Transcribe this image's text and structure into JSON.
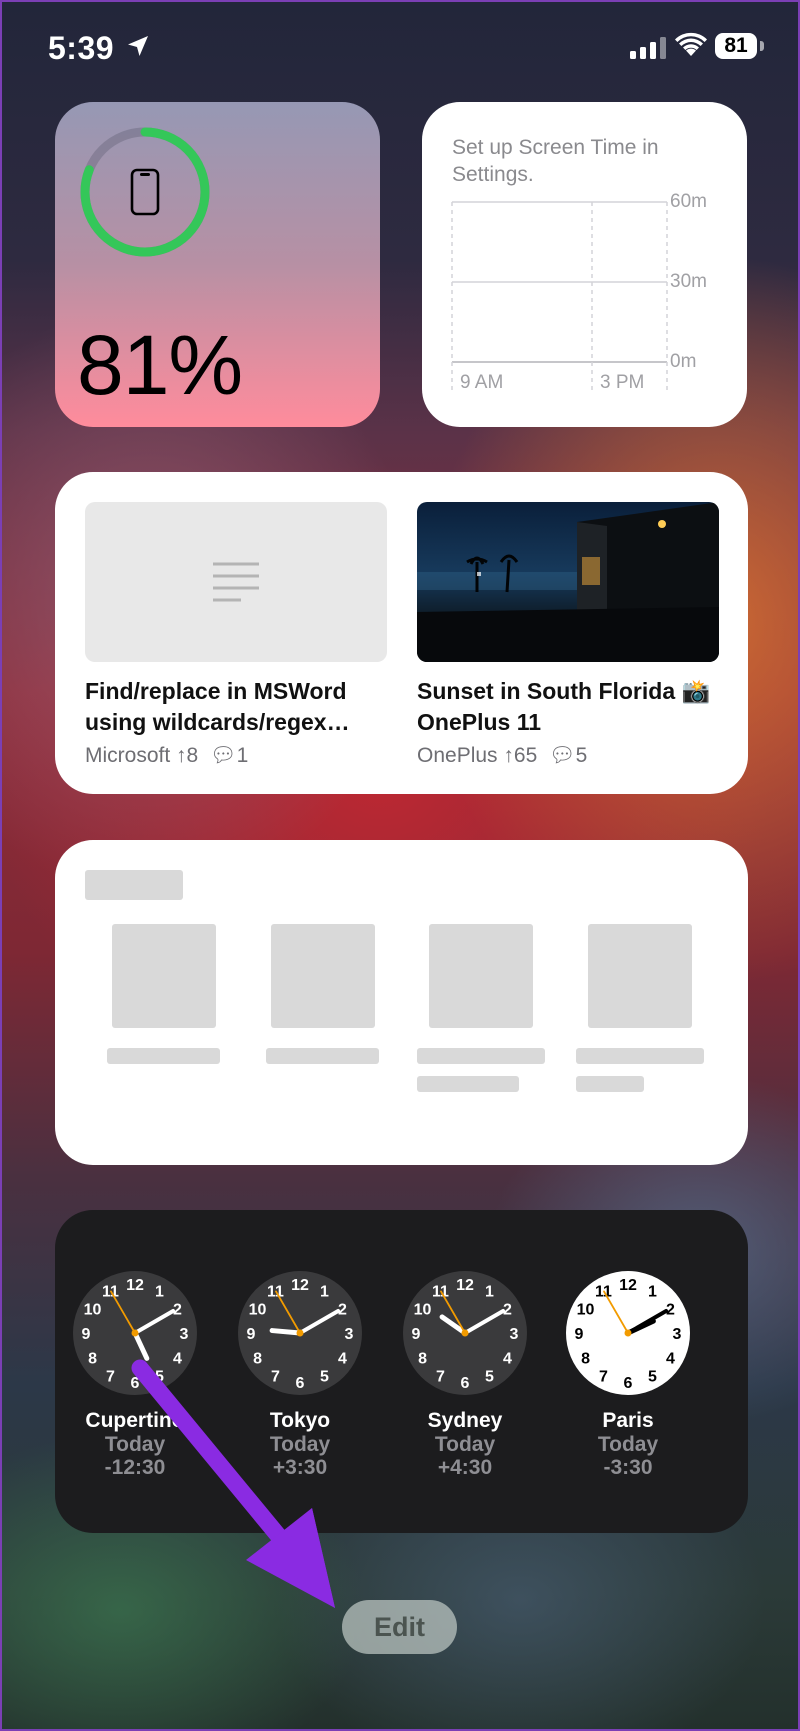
{
  "status_bar": {
    "time": "5:39",
    "battery_level": "81"
  },
  "battery_widget": {
    "percent_label": "81%",
    "charge_fraction": 0.81
  },
  "screen_time": {
    "message": "Set up Screen Time in Settings.",
    "y_labels": [
      "60m",
      "30m",
      "0m"
    ],
    "x_labels": [
      "9 AM",
      "3 PM"
    ]
  },
  "posts": [
    {
      "title": "Find/replace in MSWord using wildcards/regex…",
      "community": "Microsoft",
      "upvotes": "8",
      "comments": "1"
    },
    {
      "title": "Sunset in South Florida 📸 OnePlus 11",
      "community": "OnePlus",
      "upvotes": "65",
      "comments": "5"
    }
  ],
  "world_clock": [
    {
      "city": "Cupertino",
      "day": "Today",
      "offset": "-12:30",
      "hour": 5,
      "minute": 10,
      "second": 55,
      "theme": "dark"
    },
    {
      "city": "Tokyo",
      "day": "Today",
      "offset": "+3:30",
      "hour": 9,
      "minute": 10,
      "second": 55,
      "theme": "dark"
    },
    {
      "city": "Sydney",
      "day": "Today",
      "offset": "+4:30",
      "hour": 10,
      "minute": 10,
      "second": 55,
      "theme": "dark"
    },
    {
      "city": "Paris",
      "day": "Today",
      "offset": "-3:30",
      "hour": 2,
      "minute": 10,
      "second": 55,
      "theme": "light"
    }
  ],
  "edit_button": {
    "label": "Edit"
  },
  "colors": {
    "battery_ring": "#34c759",
    "annotation_arrow": "#8a2be2",
    "clock_second_hand": "#f29b00"
  }
}
